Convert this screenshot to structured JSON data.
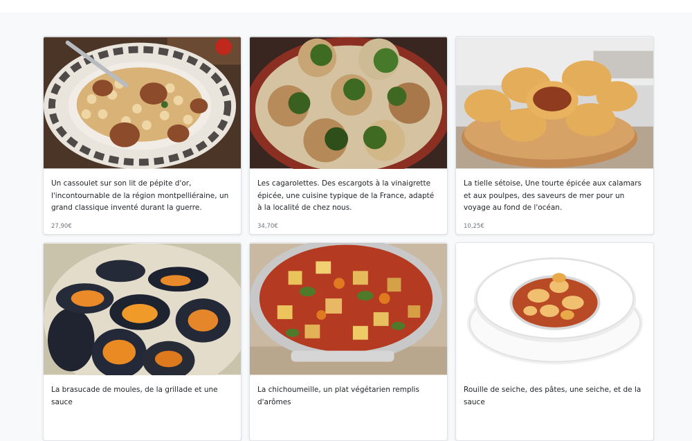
{
  "products": [
    {
      "description": "Un cassoulet sur son lit de pépite d'or, l'incontournable de la région montpelliéraine, un grand classique inventé durant la guerre.",
      "price": "27,90€",
      "image_icon": "cassoulet-photo"
    },
    {
      "description": "Les cagarolettes. Des escargots à la vinaigrette épicée, une cuisine typique de la France, adapté à la localité de chez nous.",
      "price": "34,70€",
      "image_icon": "escargots-photo"
    },
    {
      "description": "La tielle sétoise, Une tourte épicée aux calamars et aux poulpes, des saveurs de mer pour un voyage au fond de l'océan.",
      "price": "10,25€",
      "image_icon": "tielle-photo"
    },
    {
      "description": "La brasucade de moules, de la grillade et une sauce",
      "price": "",
      "image_icon": "moules-photo"
    },
    {
      "description": "La chichoumeille, un plat végétarien remplis d'arômes",
      "price": "",
      "image_icon": "ratatouille-photo"
    },
    {
      "description": "Rouille de seiche, des pâtes, une seiche, et de la sauce",
      "price": "",
      "image_icon": "rouille-seiche-photo"
    }
  ]
}
